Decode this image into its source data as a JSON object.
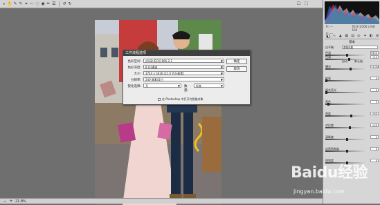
{
  "toolbar": {
    "tools": [
      "zoom-tool",
      "hand-tool",
      "white-balance-tool",
      "color-sampler-tool",
      "crop-tool",
      "straighten-tool",
      "spot-removal-tool",
      "red-eye-tool",
      "brush-tool",
      "preferences-tool",
      "rotate-left-tool",
      "rotate-right-tool"
    ],
    "right_icons": [
      "preview-toggle",
      "fullscreen-toggle"
    ]
  },
  "histogram": {
    "readout": {
      "r": "R: ---",
      "g": "G: ---",
      "b": "B: ---",
      "meta": "f/2.8  1/200 s  ISO 100"
    }
  },
  "panel": {
    "tabs": [
      "basic",
      "tone-curve",
      "detail",
      "hsl",
      "split-toning",
      "lens",
      "effects",
      "camera-calibration",
      "presets",
      "snapshots"
    ],
    "section_title": "基本",
    "white_balance": {
      "label": "白平衡:",
      "value": "原照设置"
    },
    "sliders": [
      {
        "label": "色温",
        "value": "5450",
        "fraction": 0.5
      },
      {
        "label": "色调",
        "value": "+10",
        "fraction": 0.55
      },
      {
        "label": "曝光",
        "value": "+0.50",
        "fraction": 0.58
      },
      {
        "label": "恢复",
        "value": "0",
        "fraction": 0.0
      },
      {
        "label": "填充亮光",
        "value": "0",
        "fraction": 0.0
      },
      {
        "label": "黑色",
        "value": "5",
        "fraction": 0.05
      },
      {
        "label": "亮度",
        "value": "+50",
        "fraction": 0.6
      },
      {
        "label": "对比度",
        "value": "+25",
        "fraction": 0.57
      },
      {
        "label": "清晰度",
        "value": "0",
        "fraction": 0.5
      },
      {
        "label": "自然饱和度",
        "value": "0",
        "fraction": 0.5
      },
      {
        "label": "饱和度",
        "value": "0",
        "fraction": 0.5
      }
    ],
    "auto_label": "自动",
    "default_label": "默认值"
  },
  "dialog": {
    "title": "工作流程选项",
    "rows": [
      {
        "label": "色彩空间:",
        "value": "sRGB IEC61966-2.1"
      },
      {
        "label": "色彩深度:",
        "value": "8 位/通道"
      },
      {
        "label": "大小:",
        "value": "3744 x 5616 (21.0 百万像素)"
      },
      {
        "label": "分辨率:",
        "value": "240    像素/英寸"
      },
      {
        "label": "锐化选择:",
        "value": "无"
      }
    ],
    "sharpen_amount_label": "数量:",
    "sharpen_amount_value": "标准",
    "checkbox_label": "在 Photoshop 中打开为智能对象",
    "ok_label": "确定",
    "cancel_label": "取消"
  },
  "statusbar": {
    "zoom": "21.8%"
  },
  "watermark": {
    "brand": "Baidu经验",
    "url": "jingyan.baidu.com"
  }
}
